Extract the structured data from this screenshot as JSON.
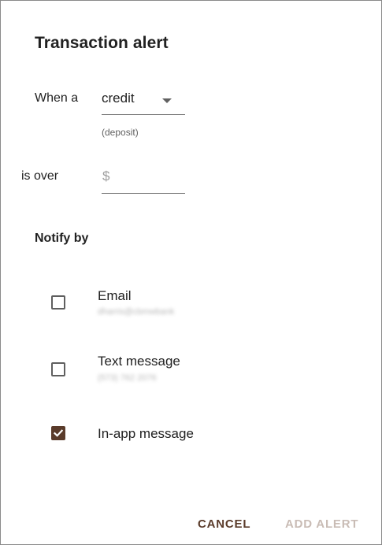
{
  "dialog": {
    "title": "Transaction alert"
  },
  "condition": {
    "when_label": "When a",
    "type_value": "credit",
    "type_helper": "(deposit)",
    "is_over_label": "is over",
    "currency_symbol": "$",
    "amount_value": ""
  },
  "notify": {
    "title": "Notify by",
    "options": [
      {
        "label": "Email",
        "detail": "dharris@cbmwbank",
        "checked": false
      },
      {
        "label": "Text message",
        "detail": "(573) 762 2076",
        "checked": false
      },
      {
        "label": "In-app message",
        "detail": "",
        "checked": true
      }
    ]
  },
  "actions": {
    "cancel_label": "CANCEL",
    "add_label": "ADD ALERT",
    "add_enabled": false
  },
  "colors": {
    "accent": "#5a3b2a",
    "disabled_text": "#c9bcb5"
  }
}
